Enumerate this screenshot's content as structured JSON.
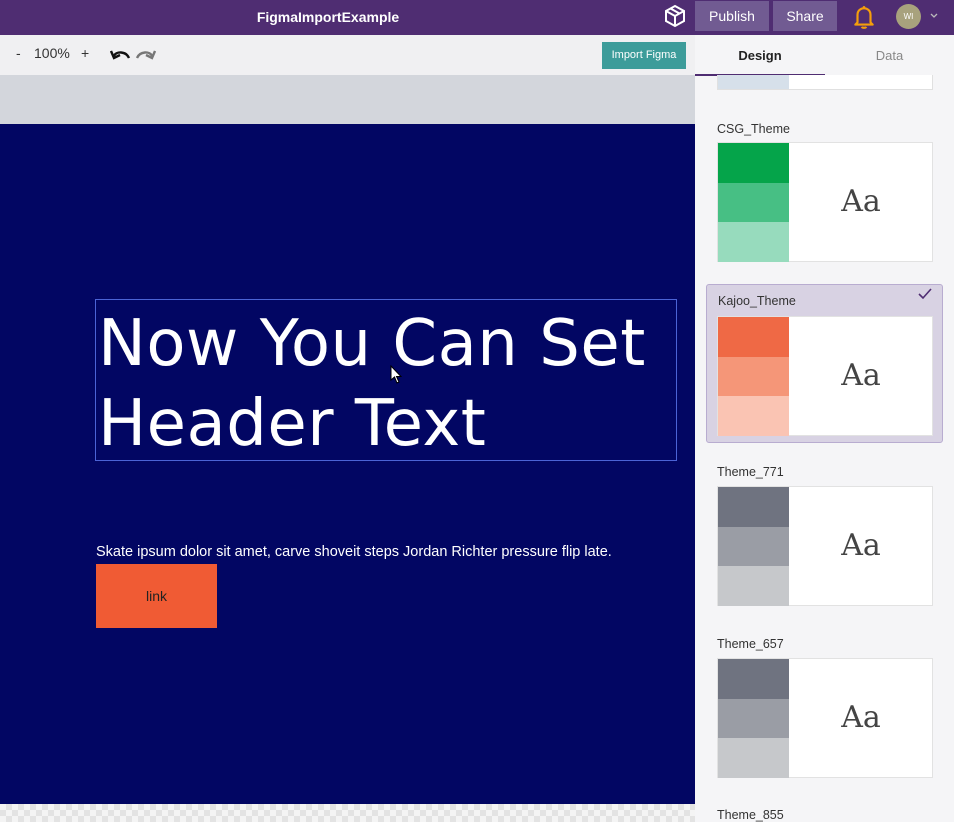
{
  "app": {
    "title": "FigmaImportExample",
    "publish_label": "Publish",
    "share_label": "Share",
    "avatar_initials": "WI",
    "icons": [
      "cube-icon",
      "bell-icon",
      "chevron-down-icon"
    ],
    "accent": "#4f2d72",
    "bell_color": "#f59e0b"
  },
  "toolbar": {
    "zoom_minus": "-",
    "zoom_value": "100%",
    "zoom_plus": "+",
    "import_label": "Import Figma",
    "import_color": "#3d9c9a"
  },
  "canvas": {
    "background": "#020663",
    "header_line1": "Now You Can Set",
    "header_line2": "Header Text",
    "body_text": "Skate ipsum dolor sit amet, carve shoveit steps Jordan Richter pressure flip late.",
    "link_label": "link",
    "link_color": "#f05b34"
  },
  "sidebar": {
    "tabs": [
      {
        "label": "Design",
        "active": true
      },
      {
        "label": "Data",
        "active": false
      }
    ],
    "themes": [
      {
        "name": "CSG_Theme",
        "sample": "Aa",
        "selected": false,
        "colors": [
          "#05a44a",
          "#47bf84",
          "#97dbbd"
        ]
      },
      {
        "name": "Kajoo_Theme",
        "sample": "Aa",
        "selected": true,
        "colors": [
          "#ef6945",
          "#f59678",
          "#fac4b3"
        ]
      },
      {
        "name": "Theme_771",
        "sample": "Aa",
        "selected": false,
        "colors": [
          "#6f7380",
          "#9a9da5",
          "#c6c8cb"
        ]
      },
      {
        "name": "Theme_657",
        "sample": "Aa",
        "selected": false,
        "colors": [
          "#6f7380",
          "#9a9da5",
          "#c6c8cb"
        ]
      },
      {
        "name": "Theme_855",
        "sample": "",
        "selected": false,
        "colors": []
      }
    ]
  }
}
